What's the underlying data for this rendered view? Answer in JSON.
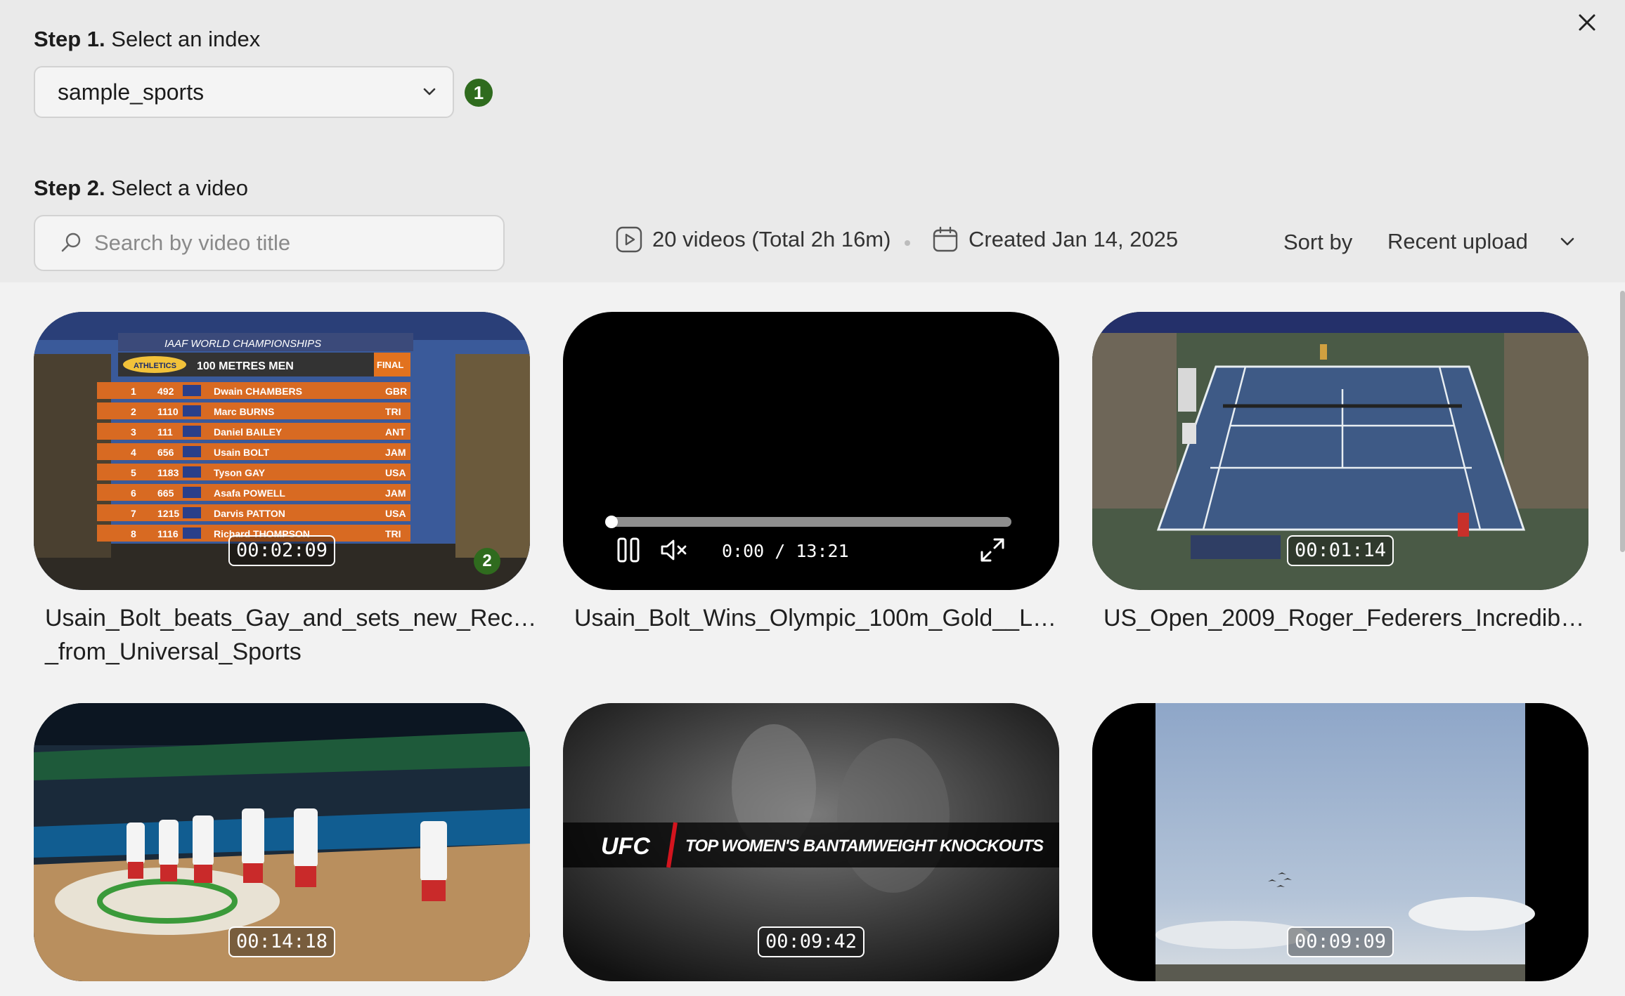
{
  "step1": {
    "bold": "Step 1.",
    "text": "Select an index"
  },
  "index_select": {
    "value": "sample_sports",
    "badge": "1"
  },
  "step2": {
    "bold": "Step 2.",
    "text": "Select a video"
  },
  "search": {
    "placeholder": "Search by video title"
  },
  "meta": {
    "videos": "20 videos (Total 2h 16m)",
    "created": "Created Jan 14, 2025"
  },
  "sort": {
    "label": "Sort by",
    "value": "Recent upload"
  },
  "videos": [
    {
      "title": "Usain_Bolt_beats_Gay_and_sets_new_Rec…\n_from_Universal_Sports",
      "duration": "00:02:09",
      "badge": "2"
    },
    {
      "title": "Usain_Bolt_Wins_Olympic_100m_Gold__L…",
      "player_time": "0:00",
      "player_total": "13:21"
    },
    {
      "title": "US_Open_2009_Roger_Federers_Incredib…",
      "duration": "00:01:14"
    },
    {
      "title": "",
      "duration": "00:14:18"
    },
    {
      "title": "",
      "duration": "00:09:42",
      "overlay_brand": "UFC",
      "overlay_text": "TOP WOMEN'S BANTAMWEIGHT KNOCKOUTS"
    },
    {
      "title": "",
      "duration": "00:09:09"
    }
  ],
  "scoreboard": {
    "header": "IAAF WORLD CHAMPIONSHIPS",
    "event": "100 METRES MEN",
    "round": "FINAL",
    "brand": "ATHLETICS",
    "rows": [
      {
        "pos": "1",
        "bib": "492",
        "name": "Dwain CHAMBERS",
        "nat": "GBR"
      },
      {
        "pos": "2",
        "bib": "1110",
        "name": "Marc BURNS",
        "nat": "TRI"
      },
      {
        "pos": "3",
        "bib": "111",
        "name": "Daniel BAILEY",
        "nat": "ANT"
      },
      {
        "pos": "4",
        "bib": "656",
        "name": "Usain BOLT",
        "nat": "JAM"
      },
      {
        "pos": "5",
        "bib": "1183",
        "name": "Tyson GAY",
        "nat": "USA"
      },
      {
        "pos": "6",
        "bib": "665",
        "name": "Asafa POWELL",
        "nat": "JAM"
      },
      {
        "pos": "7",
        "bib": "1215",
        "name": "Darvis PATTON",
        "nat": "USA"
      },
      {
        "pos": "8",
        "bib": "1116",
        "name": "Richard THOMPSON",
        "nat": "TRI"
      }
    ]
  }
}
